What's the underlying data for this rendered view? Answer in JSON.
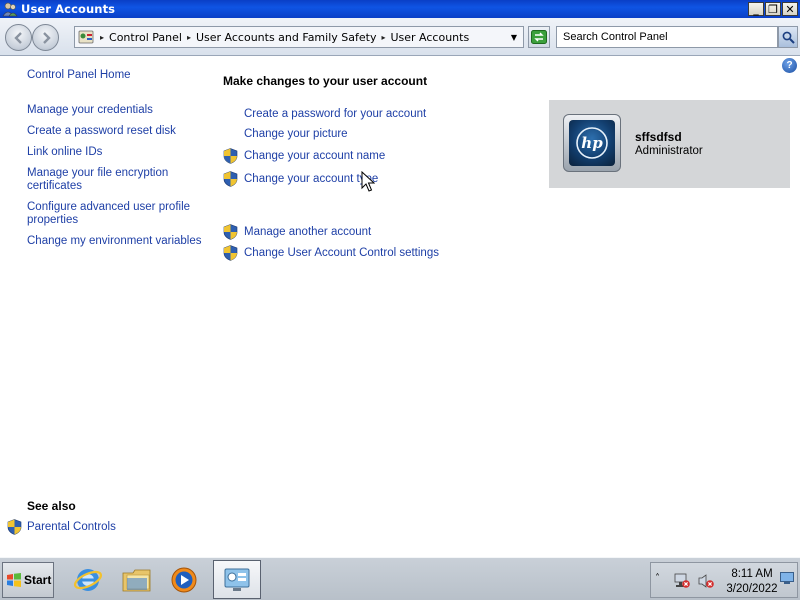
{
  "window": {
    "title": "User Accounts",
    "minimize_glyph": "_",
    "maximize_glyph": "❐",
    "close_glyph": "✕"
  },
  "addressbar": {
    "crumbs": [
      "Control Panel",
      "User Accounts and Family Safety",
      "User Accounts"
    ],
    "search_placeholder": "Search Control Panel"
  },
  "help_glyph": "?",
  "left_pane": {
    "home": "Control Panel Home",
    "links": [
      "Manage your credentials",
      "Create a password reset disk",
      "Link online IDs",
      "Manage your file encryption certificates",
      "Configure advanced user profile properties",
      "Change my environment variables"
    ]
  },
  "main": {
    "heading": "Make changes to your user account",
    "tasks": [
      {
        "label": "Create a password for your account",
        "shield": false
      },
      {
        "label": "Change your picture",
        "shield": false
      },
      {
        "label": "Change your account name",
        "shield": true
      },
      {
        "label": "Change your account type",
        "shield": true
      },
      {
        "label": "Manage another account",
        "shield": true
      },
      {
        "label": "Change User Account Control settings",
        "shield": true
      }
    ]
  },
  "account": {
    "name": "sffsdfsd",
    "role": "Administrator",
    "logo_text": "hp"
  },
  "see_also": {
    "heading": "See also",
    "links": [
      "Parental Controls"
    ]
  },
  "taskbar": {
    "start_label": "Start",
    "clock_time": "8:11 AM",
    "clock_date": "3/20/2022",
    "tray_chevron": "˄"
  },
  "colors": {
    "link": "#1e3fa6",
    "titlebar": "#0a3fc6",
    "account_panel": "#d4d6d8"
  }
}
